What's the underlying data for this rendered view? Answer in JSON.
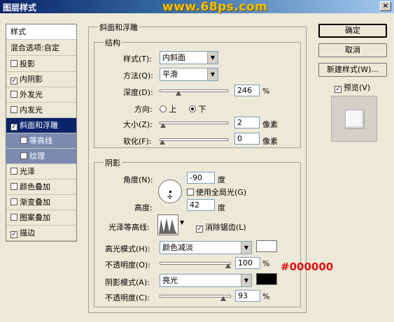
{
  "window": {
    "title": "图层样式",
    "watermark": "www.68ps.com",
    "close": "×"
  },
  "left_panel": {
    "header": "样式",
    "blend": "混合选项:自定",
    "items": [
      {
        "label": "投影",
        "checked": false
      },
      {
        "label": "内阴影",
        "checked": true
      },
      {
        "label": "外发光",
        "checked": false
      },
      {
        "label": "内发光",
        "checked": false
      },
      {
        "label": "斜面和浮雕",
        "checked": true
      },
      {
        "label": "等高线",
        "checked": false
      },
      {
        "label": "纹理",
        "checked": false
      },
      {
        "label": "光泽",
        "checked": false
      },
      {
        "label": "颜色叠加",
        "checked": false
      },
      {
        "label": "渐变叠加",
        "checked": false
      },
      {
        "label": "图案叠加",
        "checked": false
      },
      {
        "label": "描边",
        "checked": true
      }
    ]
  },
  "bevel": {
    "group_title": "斜面和浮雕",
    "structure": {
      "title": "结构",
      "style_label": "样式(T):",
      "style_value": "内斜面",
      "method_label": "方法(Q):",
      "method_value": "平滑",
      "depth_label": "深度(D):",
      "depth_value": "246",
      "depth_unit": "%",
      "depth_level": 0.25,
      "direction_label": "方向:",
      "dir_up": "上",
      "dir_down": "下",
      "size_label": "大小(Z):",
      "size_value": "2",
      "size_unit": "像素",
      "size_level": 0.01,
      "soften_label": "软化(F):",
      "soften_value": "0",
      "soften_unit": "像素",
      "soften_level": 0
    },
    "shading": {
      "title": "阴影",
      "angle_label": "角度(N):",
      "angle_value": "-90",
      "angle_unit": "度",
      "global_light": "使用全局光(G)",
      "altitude_label": "高度:",
      "altitude_value": "42",
      "altitude_unit": "度",
      "gloss_label": "光泽等高线:",
      "antialias": "消除锯齿(L)",
      "highlight_label": "高光模式(H):",
      "highlight_mode": "颜色减淡",
      "highlight_color": "#ffffff",
      "opacity1_label": "不透明度(O):",
      "opacity1_value": "100",
      "opacity1_unit": "%",
      "opacity1_level": 1.0,
      "shadow_label": "阴影模式(A):",
      "shadow_mode": "亮光",
      "shadow_color": "#000000",
      "opacity2_label": "不透明度(C):",
      "opacity2_value": "93",
      "opacity2_unit": "%",
      "opacity2_level": 0.93
    }
  },
  "right": {
    "ok": "确定",
    "cancel": "取消",
    "new_style": "新建样式(W)...",
    "preview": "预览(V)"
  },
  "annotation": "#000000"
}
